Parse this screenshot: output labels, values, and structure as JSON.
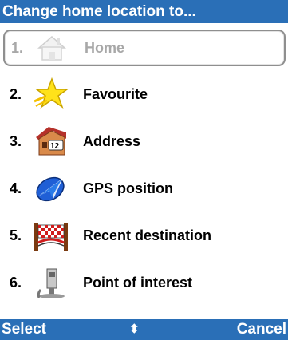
{
  "title": "Change home location to...",
  "menu": {
    "items": [
      {
        "number": "1.",
        "label": "Home",
        "icon": "house-icon",
        "selected": true
      },
      {
        "number": "2.",
        "label": "Favourite",
        "icon": "star-icon"
      },
      {
        "number": "3.",
        "label": "Address",
        "icon": "building-address-icon"
      },
      {
        "number": "4.",
        "label": "GPS position",
        "icon": "gps-arrow-icon"
      },
      {
        "number": "5.",
        "label": "Recent destination",
        "icon": "finish-flag-icon"
      },
      {
        "number": "6.",
        "label": "Point of interest",
        "icon": "poi-icon"
      }
    ]
  },
  "softkeys": {
    "left": "Select",
    "middle": "⬍",
    "right": "Cancel"
  },
  "colors": {
    "bar": "#2a6fb7",
    "selected_border": "#8f8f8f",
    "selected_text": "#a8a8a8"
  }
}
